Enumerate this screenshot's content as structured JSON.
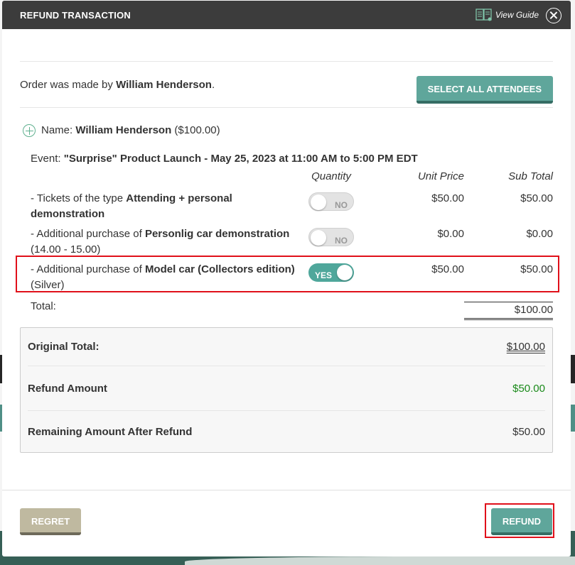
{
  "modal": {
    "title": "REFUND TRANSACTION",
    "view_guide": "View Guide"
  },
  "order": {
    "prefix": "Order was made by ",
    "customer": "William Henderson",
    "suffix": ".",
    "select_all": "SELECT ALL ATTENDEES"
  },
  "attendee": {
    "name_label": "Name: ",
    "name": "William Henderson",
    "amount": "($100.00)"
  },
  "event": {
    "label": "Event: ",
    "name": "\"Surprise\" Product Launch - May 25, 2023 at 11:00 AM to 5:00 PM EDT"
  },
  "table": {
    "headers": [
      "Quantity",
      "Unit Price",
      "Sub Total"
    ],
    "items": [
      {
        "prefix": "- Tickets of the type ",
        "bold": "Attending + personal demonstration",
        "suffix": "",
        "toggle": "NO",
        "unit_price": "$50.00",
        "sub_total": "$50.00"
      },
      {
        "prefix": "- Additional purchase of ",
        "bold": "Personlig car demonstration",
        "suffix": " (14.00 - 15.00)",
        "toggle": "NO",
        "unit_price": "$0.00",
        "sub_total": "$0.00"
      },
      {
        "prefix": "- Additional purchase of ",
        "bold": "Model car (Collectors edition)",
        "suffix": " (Silver)",
        "toggle": "YES",
        "unit_price": "$50.00",
        "sub_total": "$50.00"
      }
    ],
    "total_label": "Total:",
    "total_value": "$100.00"
  },
  "summary": {
    "original_label": "Original Total:",
    "original_value": "$100.00",
    "refund_label": "Refund Amount",
    "refund_value": "$50.00",
    "remaining_label": "Remaining Amount After Refund",
    "remaining_value": "$50.00"
  },
  "footer": {
    "regret": "REGRET",
    "refund": "REFUND"
  },
  "colors": {
    "header_bg": "#3c3c3c",
    "accent_teal": "#5fa69b",
    "highlight_red": "#e0101a",
    "refund_green": "#1a8a1a"
  }
}
